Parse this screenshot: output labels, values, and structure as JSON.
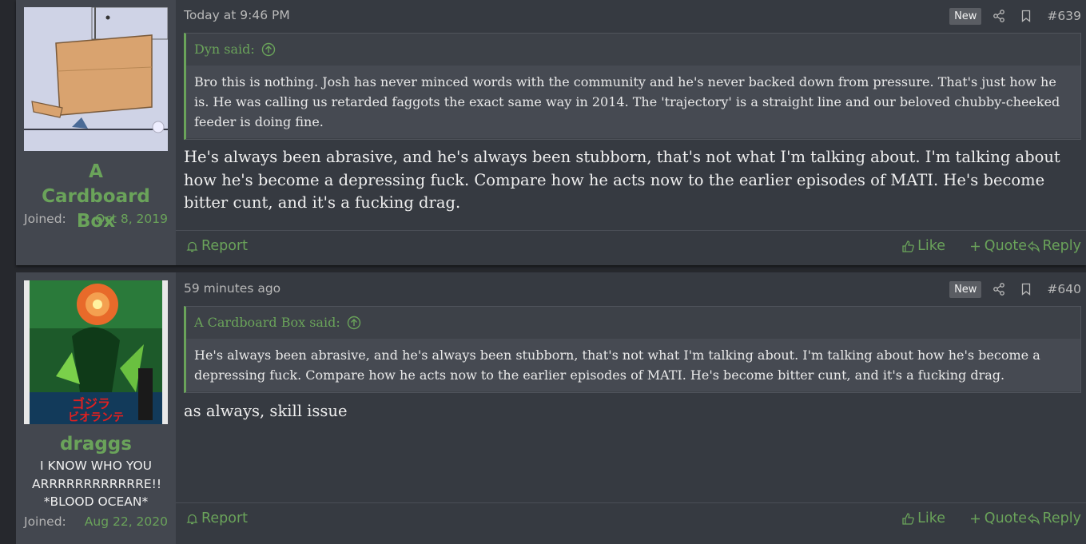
{
  "posts": [
    {
      "author": "A Cardboard Box",
      "user_title": "",
      "joined_label": "Joined:",
      "joined_date": "Oct 8, 2019",
      "time": "Today at 9:46 PM",
      "badge": "New",
      "number": "#639",
      "quote": {
        "author_line": "Dyn said:",
        "text": "Bro this is nothing. Josh has never minced words with the community and he's never backed down from pressure. That's just how he is. He was calling us retarded faggots the exact same way in 2014. The 'trajectory' is a straight line and our beloved chubby-cheeked feeder is doing fine."
      },
      "content": "He's always been abrasive, and he's always been stubborn, that's not what I'm talking about. I'm talking about how he's become a depressing fuck. Compare how he acts now to the earlier episodes of MATI. He's become bitter cunt, and it's a fucking drag.",
      "actions": {
        "report": "Report",
        "like": "Like",
        "quote": "Quote",
        "reply": "Reply"
      }
    },
    {
      "author": "draggs",
      "user_title": "I KNOW WHO YOU ARRRRRRRRRRRRE!! *BLOOD OCEAN*",
      "joined_label": "Joined:",
      "joined_date": "Aug 22, 2020",
      "time": "59 minutes ago",
      "badge": "New",
      "number": "#640",
      "quote": {
        "author_line": "A Cardboard Box said:",
        "text": "He's always been abrasive, and he's always been stubborn, that's not what I'm talking about. I'm talking about how he's become a depressing fuck. Compare how he acts now to the earlier episodes of MATI. He's become bitter cunt, and it's a fucking drag."
      },
      "content": "as always, skill issue",
      "actions": {
        "report": "Report",
        "like": "Like",
        "quote": "Quote",
        "reply": "Reply"
      }
    }
  ],
  "icons": {
    "share": "share-icon",
    "bookmark": "bookmark-icon",
    "quote_up": "arrow-up-circle-icon",
    "report": "bell-icon",
    "like": "thumbs-up-icon",
    "quote": "plus-icon",
    "reply": "reply-icon"
  },
  "colors": {
    "accent": "#6aa35a",
    "background": "#26282d",
    "post_bg": "#363a41",
    "sidebar_bg": "#43474f"
  }
}
